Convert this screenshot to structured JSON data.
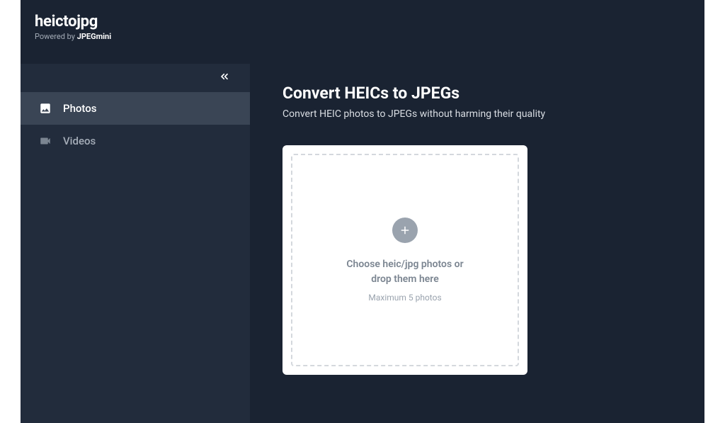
{
  "header": {
    "logo": "heictojpg",
    "powered_prefix": "Powered by ",
    "powered_brand": "JPEGmini"
  },
  "sidebar": {
    "items": [
      {
        "label": "Photos"
      },
      {
        "label": "Videos"
      }
    ]
  },
  "main": {
    "title": "Convert HEICs to JPEGs",
    "subtitle": "Convert HEIC photos to JPEGs without harming their quality",
    "dropzone": {
      "line1": "Choose heic/jpg photos or",
      "line2": "drop them here",
      "sub": "Maximum 5 photos"
    }
  }
}
